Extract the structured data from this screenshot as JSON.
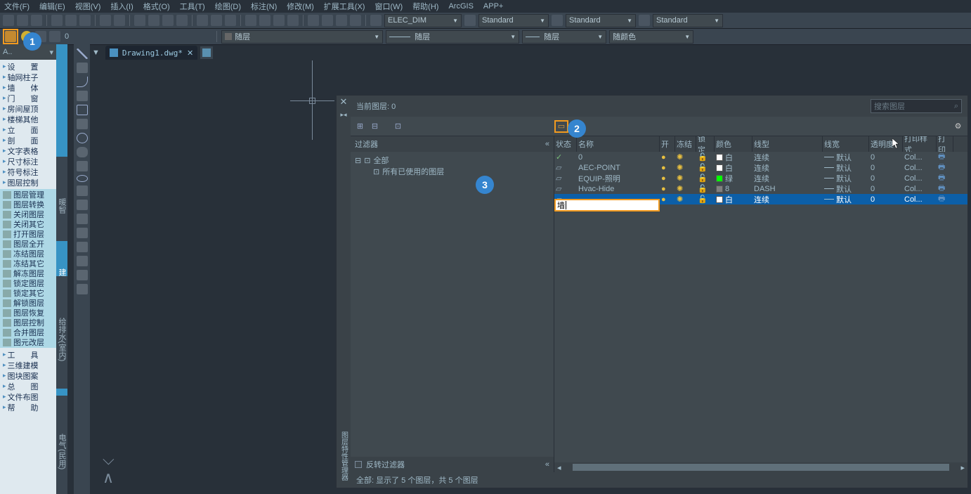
{
  "menu": [
    "文件(F)",
    "编辑(E)",
    "视图(V)",
    "插入(I)",
    "格式(O)",
    "工具(T)",
    "绘图(D)",
    "标注(N)",
    "修改(M)",
    "扩展工具(X)",
    "窗口(W)",
    "帮助(H)",
    "ArcGIS",
    "APP+"
  ],
  "toolbar2": {
    "styledrop1": "ELEC_DIM",
    "styledrop2": "Standard",
    "styledrop3": "Standard",
    "styledrop4": "Standard"
  },
  "toolbar3": {
    "layer_drop": "随层",
    "ltype_drop": "随层",
    "lw_drop": "随层",
    "color_drop": "随颜色"
  },
  "left_head": "A..",
  "tree_top": [
    {
      "label": "设　　置"
    },
    {
      "label": "轴网柱子"
    },
    {
      "label": "墙　　体"
    },
    {
      "label": "门　　窗"
    },
    {
      "label": "房间屋顶"
    },
    {
      "label": "楼梯其他"
    },
    {
      "label": "立　　面"
    },
    {
      "label": "剖　　面"
    },
    {
      "label": "文字表格"
    },
    {
      "label": "尺寸标注"
    },
    {
      "label": "符号标注"
    },
    {
      "label": "图层控制"
    }
  ],
  "sub_layer": [
    "图层管理",
    "图层转换",
    "关闭图层",
    "关闭其它",
    "打开图层",
    "图层全开",
    "冻结图层",
    "冻结其它",
    "解冻图层",
    "锁定图层",
    "锁定其它",
    "解锁图层",
    "图层恢复",
    "图层控制",
    "合并图层",
    "图元改层"
  ],
  "tree_bottom": [
    {
      "label": "工　　具"
    },
    {
      "label": "三维建模"
    },
    {
      "label": "图块图案"
    },
    {
      "label": "总　　图"
    },
    {
      "label": "文件布图"
    },
    {
      "label": "帮　　助"
    }
  ],
  "vtab1": "建筑",
  "vtab2": "暖智",
  "vtab3": "给排水(室内)",
  "vtab4": "电气(民用)",
  "doc_tab": "Drawing1.dwg*",
  "layer_panel": {
    "title": "当前图层: 0",
    "search_ph": "搜索图层",
    "filter_head": "过滤器",
    "filter_root": "全部",
    "filter_used": "所有已使用的图层",
    "invert": "反转过滤器",
    "status": "全部:  显示了 5 个图层，共 5 个图层",
    "vtitle": "图层特性管理器",
    "columns": [
      "状态",
      "名称",
      "开",
      "冻结",
      "锁定",
      "颜色",
      "线型",
      "线宽",
      "透明度",
      "打印样式",
      "打印"
    ],
    "rows": [
      {
        "name": "0",
        "color": "白",
        "csw": "#ffffff",
        "ltype": "连续",
        "lw": "默认",
        "tr": "0",
        "ps": "Col...",
        "current": true
      },
      {
        "name": "AEC-POINT",
        "color": "白",
        "csw": "#ffffff",
        "ltype": "连续",
        "lw": "默认",
        "tr": "0",
        "ps": "Col..."
      },
      {
        "name": "EQUIP-照明",
        "color": "绿",
        "csw": "#00ff00",
        "ltype": "连续",
        "lw": "默认",
        "tr": "0",
        "ps": "Col..."
      },
      {
        "name": "Hvac-Hide",
        "color": "8",
        "csw": "#808080",
        "ltype": "DASH",
        "lw": "默认",
        "tr": "0",
        "ps": "Col..."
      },
      {
        "name": "墙",
        "color": "白",
        "csw": "#ffffff",
        "ltype": "连续",
        "lw": "默认",
        "tr": "0",
        "ps": "Col...",
        "editing": true,
        "selected": true
      }
    ]
  },
  "badges": {
    "b1": "1",
    "b2": "2",
    "b3": "3"
  },
  "collapse": "«"
}
